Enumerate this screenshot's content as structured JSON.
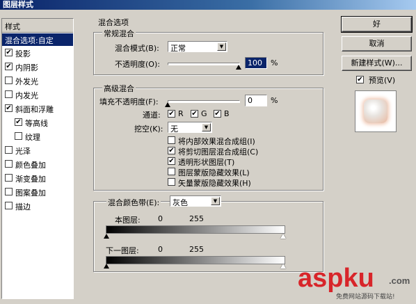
{
  "window": {
    "title": "图层样式"
  },
  "left_pane": {
    "header": "样式",
    "selected": "混合选项:自定",
    "items": [
      {
        "label": "投影",
        "checked": true
      },
      {
        "label": "内阴影",
        "checked": true
      },
      {
        "label": "外发光",
        "checked": false
      },
      {
        "label": "内发光",
        "checked": false
      },
      {
        "label": "斜面和浮雕",
        "checked": true
      },
      {
        "label": "等高线",
        "checked": true
      },
      {
        "label": "纹理",
        "checked": false
      },
      {
        "label": "光泽",
        "checked": false
      },
      {
        "label": "颜色叠加",
        "checked": false
      },
      {
        "label": "渐变叠加",
        "checked": false
      },
      {
        "label": "图案叠加",
        "checked": false
      },
      {
        "label": "描边",
        "checked": false
      }
    ]
  },
  "blending_options": {
    "title": "混合选项",
    "general": {
      "title": "常规混合",
      "blend_mode_label": "混合模式(B):",
      "blend_mode_value": "正常",
      "opacity_label": "不透明度(O):",
      "opacity_value": "100",
      "opacity_unit": "%"
    },
    "advanced": {
      "title": "高级混合",
      "fill_opacity_label": "填充不透明度(F):",
      "fill_opacity_value": "0",
      "fill_opacity_unit": "%",
      "channels_label": "通道:",
      "channels": [
        {
          "label": "R",
          "checked": true
        },
        {
          "label": "G",
          "checked": true
        },
        {
          "label": "B",
          "checked": true
        }
      ],
      "knockout_label": "挖空(K):",
      "knockout_value": "无",
      "options": [
        {
          "label": "将内部效果混合成组(I)",
          "checked": false
        },
        {
          "label": "将剪切图层混合成组(C)",
          "checked": true
        },
        {
          "label": "透明形状图层(T)",
          "checked": true
        },
        {
          "label": "图层蒙版隐藏效果(L)",
          "checked": false
        },
        {
          "label": "矢量蒙版隐藏效果(H)",
          "checked": false
        }
      ]
    },
    "blend_if": {
      "label": "混合颜色带(E):",
      "value": "灰色",
      "this_layer_label": "本图层:",
      "this_layer_min": "0",
      "this_layer_max": "255",
      "underlying_label": "下一图层:",
      "underlying_min": "0",
      "underlying_max": "255"
    }
  },
  "buttons": {
    "ok": "好",
    "cancel": "取消",
    "new_style": "新建样式(W)...",
    "preview_label": "预览(V)",
    "preview_checked": true
  },
  "watermark": {
    "brand": "aspku",
    "tld": ".com",
    "tagline": "免费网站源码下载站!"
  }
}
